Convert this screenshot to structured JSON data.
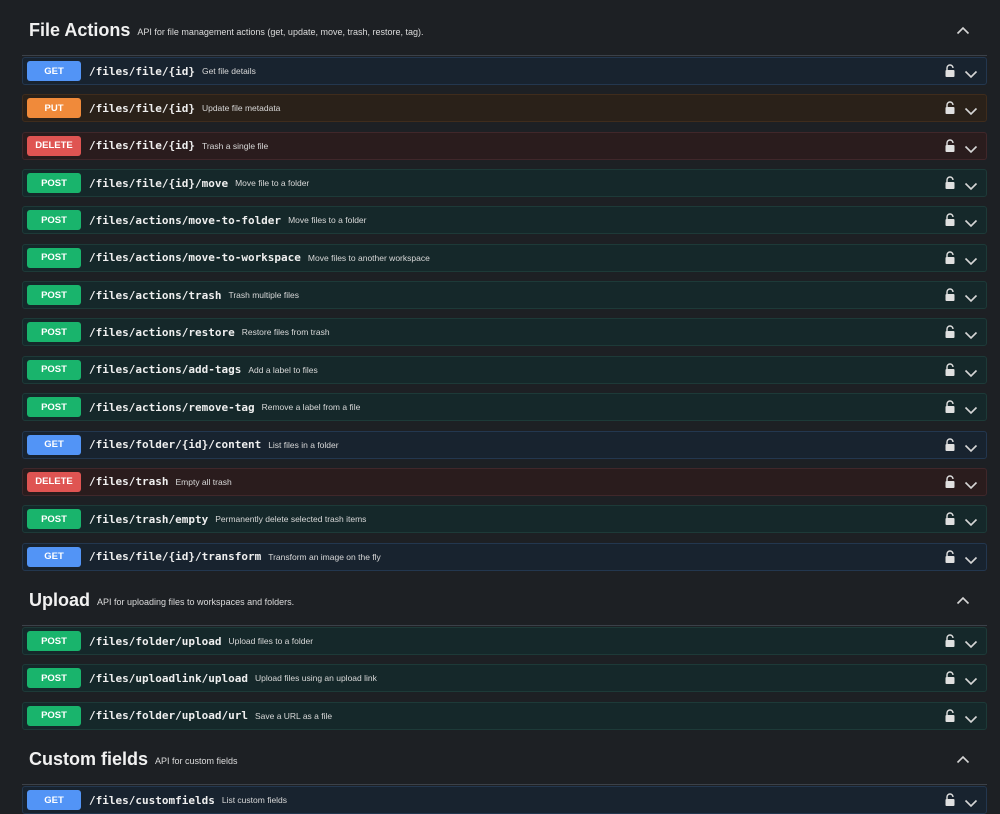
{
  "sections": [
    {
      "title": "File Actions",
      "description": "API for file management actions (get, update, move, trash, restore, tag).",
      "operations": [
        {
          "method": "GET",
          "path": "/files/file/{id}",
          "summary": "Get file details"
        },
        {
          "method": "PUT",
          "path": "/files/file/{id}",
          "summary": "Update file metadata"
        },
        {
          "method": "DELETE",
          "path": "/files/file/{id}",
          "summary": "Trash a single file"
        },
        {
          "method": "POST",
          "path": "/files/file/{id}/move",
          "summary": "Move file to a folder"
        },
        {
          "method": "POST",
          "path": "/files/actions/move-to-folder",
          "summary": "Move files to a folder"
        },
        {
          "method": "POST",
          "path": "/files/actions/move-to-workspace",
          "summary": "Move files to another workspace"
        },
        {
          "method": "POST",
          "path": "/files/actions/trash",
          "summary": "Trash multiple files"
        },
        {
          "method": "POST",
          "path": "/files/actions/restore",
          "summary": "Restore files from trash"
        },
        {
          "method": "POST",
          "path": "/files/actions/add-tags",
          "summary": "Add a label to files"
        },
        {
          "method": "POST",
          "path": "/files/actions/remove-tag",
          "summary": "Remove a label from a file"
        },
        {
          "method": "GET",
          "path": "/files/folder/{id}/content",
          "summary": "List files in a folder"
        },
        {
          "method": "DELETE",
          "path": "/files/trash",
          "summary": "Empty all trash"
        },
        {
          "method": "POST",
          "path": "/files/trash/empty",
          "summary": "Permanently delete selected trash items"
        },
        {
          "method": "GET",
          "path": "/files/file/{id}/transform",
          "summary": "Transform an image on the fly"
        }
      ]
    },
    {
      "title": "Upload",
      "description": "API for uploading files to workspaces and folders.",
      "operations": [
        {
          "method": "POST",
          "path": "/files/folder/upload",
          "summary": "Upload files to a folder"
        },
        {
          "method": "POST",
          "path": "/files/uploadlink/upload",
          "summary": "Upload files using an upload link"
        },
        {
          "method": "POST",
          "path": "/files/folder/upload/url",
          "summary": "Save a URL as a file"
        }
      ]
    },
    {
      "title": "Custom fields",
      "description": "API for custom fields",
      "operations": [
        {
          "method": "GET",
          "path": "/files/customfields",
          "summary": "List custom fields"
        }
      ]
    }
  ],
  "colors": {
    "background": "#1d2024",
    "get": "#5294f6",
    "put": "#f08a3a",
    "delete": "#df5452",
    "post": "#19b46c"
  },
  "icons": {
    "lock": "lock-icon",
    "expand": "chevron-down-icon",
    "collapse": "chevron-up-icon"
  }
}
